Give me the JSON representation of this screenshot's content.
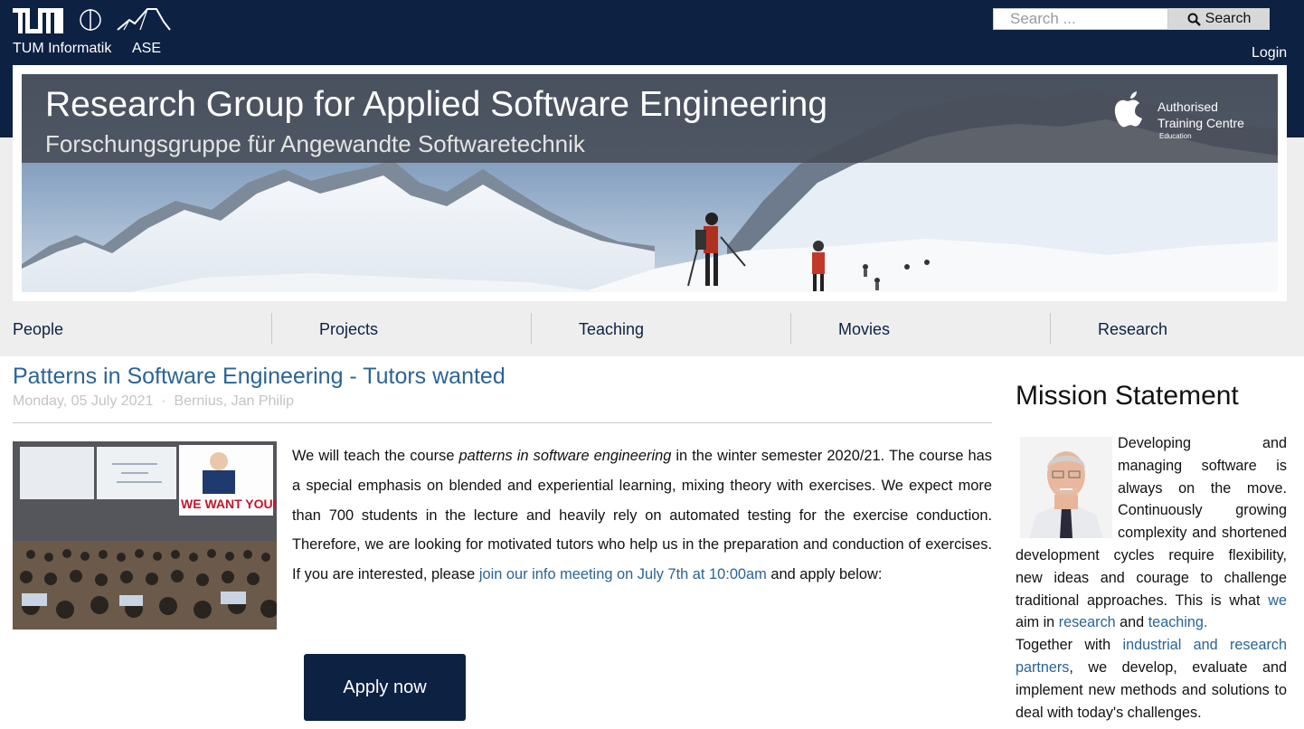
{
  "header": {
    "logos": [
      {
        "icon": "tum-logo",
        "label": "TUM Informatik"
      },
      {
        "icon": "informatik-logo"
      },
      {
        "icon": "ase-mountain-logo",
        "label": "ASE"
      }
    ],
    "search": {
      "placeholder": "Search ...",
      "button_label": "Search",
      "icon": "magnifier-icon"
    },
    "login_label": "Login",
    "colors": {
      "primary": "#0d2143",
      "link": "#2a6496",
      "grey_background": "#eeeeee"
    }
  },
  "banner": {
    "title": "Research Group for Applied Software Engineering",
    "subtitle": "Forschungsgruppe für Angewandte Softwaretechnik",
    "badge": {
      "icon": "apple-logo",
      "line1": "Authorised",
      "line2": "Training Centre",
      "line3": "Education"
    },
    "image": "snowy-mountains-with-hikers"
  },
  "nav": {
    "items": [
      {
        "label": "People"
      },
      {
        "label": "Projects"
      },
      {
        "label": "Teaching"
      },
      {
        "label": "Movies"
      },
      {
        "label": "Research"
      }
    ]
  },
  "article": {
    "title": "Patterns in Software Engineering - Tutors wanted",
    "date": "Monday, 05 July 2021",
    "separator": "·",
    "author": "Bernius, Jan Philip",
    "image": {
      "caption_text": "WE WANT YOU!",
      "description": "lecture-hall-photo"
    },
    "body": {
      "p1": "We will teach the course ",
      "emphasis": "patterns in software engineering",
      "p2": " in the winter semester 2020/21. The course has a special emphasis on blended and experiential learning, mixing theory with exercises. We expect more than 700 students in the lecture and heavily rely on automated testing for the exercise conduction. Therefore, we are looking for motivated tutors who help us in the preparation and conduction of exercises. If you are interested, please ",
      "link": "join our info meeting on July 7th at 10:00am",
      "p3": " and apply below:"
    },
    "apply_label": "Apply now"
  },
  "sidebar": {
    "title": "Mission Statement",
    "portrait": "professor-portrait",
    "text1": "Developing and managing software is always on the move. Continuously growing complexity and shortened development cycles require flexibility, new ideas and courage to challenge traditional approaches. This is what ",
    "link_we": "we",
    "text2": " aim in ",
    "link_research": "research",
    "text3": " and ",
    "link_teaching": "teaching.",
    "text4": "Together with ",
    "link_partners": "industrial and research partners",
    "text5": ", we develop, evaluate and implement new methods and solutions to deal with today's challenges."
  }
}
